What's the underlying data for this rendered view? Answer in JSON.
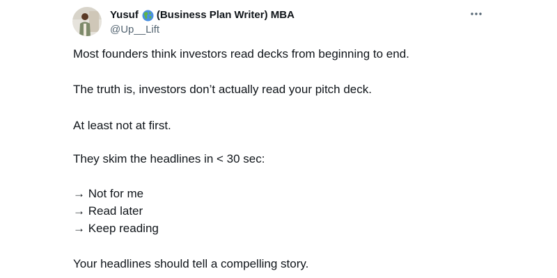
{
  "author": {
    "name_prefix": "Yusuf",
    "name_suffix": "(Business Plan Writer) MBA",
    "emoji_icon": "globe-americas-icon",
    "handle": "@Up__Lift",
    "avatar_icon": "profile-avatar"
  },
  "more_icon": "more-horizontal-icon",
  "tweet": {
    "lines": [
      "Most founders think investors read decks from beginning to end.",
      "The truth is, investors don’t actually read your pitch deck.",
      "At least not at first.",
      "They skim the headlines in < 30 sec:",
      "→ Not for me",
      "→ Read later",
      "→ Keep reading",
      "Your headlines should tell a compelling story."
    ]
  },
  "colors": {
    "text_primary": "#0f1419",
    "text_secondary": "#536471",
    "globe_ocean": "#4a90e2",
    "globe_land": "#5fb548"
  }
}
